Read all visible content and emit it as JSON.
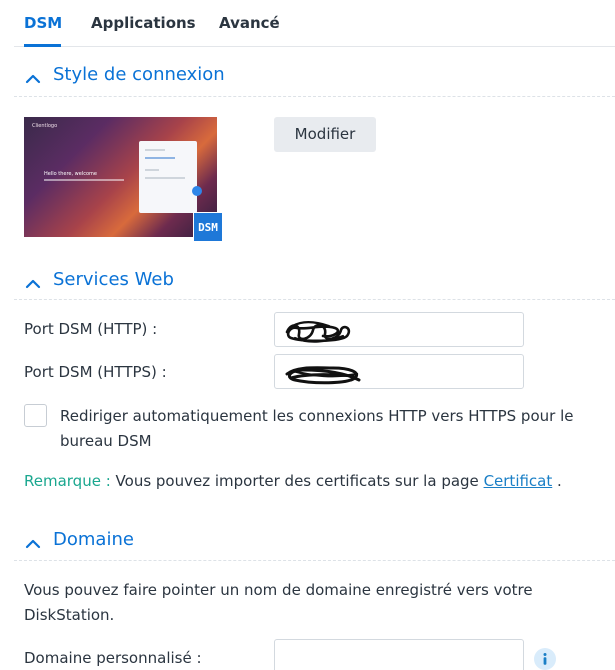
{
  "tabs": [
    {
      "label": "DSM",
      "active": true
    },
    {
      "label": "Applications",
      "active": false
    },
    {
      "label": "Avancé",
      "active": false
    }
  ],
  "colors": {
    "accent": "#0a72d6",
    "remark": "#1aa78f",
    "link": "#1a7fc6"
  },
  "login_style": {
    "title": "Style de connexion",
    "chevron": "chevron-up-icon",
    "modify_button": "Modifier",
    "preview": {
      "logo_text": "Clientlogo",
      "welcome_text": "Hello there, welcome",
      "badge": "DSM"
    }
  },
  "web_services": {
    "title": "Services Web",
    "chevron": "chevron-up-icon",
    "http_label": "Port DSM (HTTP) :",
    "https_label": "Port DSM (HTTPS) :",
    "redirect_label": "Rediriger automatiquement les connexions HTTP vers HTTPS pour le bureau DSM",
    "redirect_checked": false,
    "remark_label": "Remarque :",
    "remark_text": "Vous pouvez importer des certificats sur la page",
    "remark_link": "Certificat",
    "remark_end": "."
  },
  "domain": {
    "title": "Domaine",
    "chevron": "chevron-up-icon",
    "description": "Vous pouvez faire pointer un nom de domaine enregistré vers votre DiskStation.",
    "custom_label": "Domaine personnalisé :",
    "custom_value": "",
    "info_icon": "info-icon"
  }
}
